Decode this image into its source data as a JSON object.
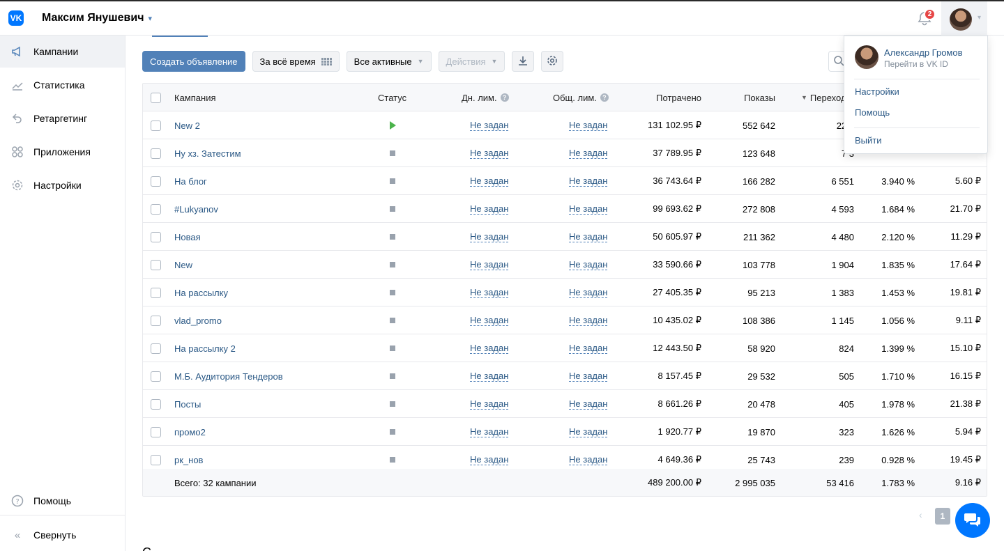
{
  "header": {
    "logo_text": "VK",
    "account_name": "Максим Янушевич",
    "notifications_count": "2"
  },
  "sidebar": {
    "items": [
      {
        "label": "Кампании",
        "icon": "megaphone-icon",
        "active": true
      },
      {
        "label": "Статистика",
        "icon": "chart-icon"
      },
      {
        "label": "Ретаргетинг",
        "icon": "retarget-icon"
      },
      {
        "label": "Приложения",
        "icon": "apps-icon"
      },
      {
        "label": "Настройки",
        "icon": "gear-icon"
      }
    ],
    "help_label": "Помощь",
    "collapse_label": "Свернуть"
  },
  "toolbar": {
    "create_label": "Создать объявление",
    "period_label": "За всё время",
    "filter_label": "Все активные",
    "actions_label": "Действия"
  },
  "table": {
    "columns": {
      "name": "Кампания",
      "status": "Статус",
      "day_limit": "Дн. лим.",
      "total_limit": "Общ. лим.",
      "spent": "Потрачено",
      "impressions": "Показы",
      "clicks": "Переходы"
    },
    "limit_text": "Не задан",
    "rows": [
      {
        "name": "New 2",
        "status": "active",
        "spent": "131 102.95 ₽",
        "impressions": "552 642",
        "clicks": "22 8",
        "ctr": "",
        "cpc": ""
      },
      {
        "name": "Ну хз. Затестим",
        "status": "stopped",
        "spent": "37 789.95 ₽",
        "impressions": "123 648",
        "clicks": "7 3",
        "ctr": "",
        "cpc": ""
      },
      {
        "name": "На блог",
        "status": "stopped",
        "spent": "36 743.64 ₽",
        "impressions": "166 282",
        "clicks": "6 551",
        "ctr": "3.940 %",
        "cpc": "5.60 ₽"
      },
      {
        "name": "#Lukyanov",
        "status": "stopped",
        "spent": "99 693.62 ₽",
        "impressions": "272 808",
        "clicks": "4 593",
        "ctr": "1.684 %",
        "cpc": "21.70 ₽"
      },
      {
        "name": "Новая",
        "status": "stopped",
        "spent": "50 605.97 ₽",
        "impressions": "211 362",
        "clicks": "4 480",
        "ctr": "2.120 %",
        "cpc": "11.29 ₽"
      },
      {
        "name": "New",
        "status": "stopped",
        "spent": "33 590.66 ₽",
        "impressions": "103 778",
        "clicks": "1 904",
        "ctr": "1.835 %",
        "cpc": "17.64 ₽"
      },
      {
        "name": "На рассылку",
        "status": "stopped",
        "spent": "27 405.35 ₽",
        "impressions": "95 213",
        "clicks": "1 383",
        "ctr": "1.453 %",
        "cpc": "19.81 ₽"
      },
      {
        "name": "vlad_promo",
        "status": "stopped",
        "spent": "10 435.02 ₽",
        "impressions": "108 386",
        "clicks": "1 145",
        "ctr": "1.056 %",
        "cpc": "9.11 ₽"
      },
      {
        "name": "На рассылку 2",
        "status": "stopped",
        "spent": "12 443.50 ₽",
        "impressions": "58 920",
        "clicks": "824",
        "ctr": "1.399 %",
        "cpc": "15.10 ₽"
      },
      {
        "name": "М.Б. Аудитория Тендеров",
        "status": "stopped",
        "spent": "8 157.45 ₽",
        "impressions": "29 532",
        "clicks": "505",
        "ctr": "1.710 %",
        "cpc": "16.15 ₽"
      },
      {
        "name": "Посты",
        "status": "stopped",
        "spent": "8 661.26 ₽",
        "impressions": "20 478",
        "clicks": "405",
        "ctr": "1.978 %",
        "cpc": "21.38 ₽"
      },
      {
        "name": "промо2",
        "status": "stopped",
        "spent": "1 920.77 ₽",
        "impressions": "19 870",
        "clicks": "323",
        "ctr": "1.626 %",
        "cpc": "5.94 ₽"
      },
      {
        "name": "рк_нов",
        "status": "stopped",
        "spent": "4 649.36 ₽",
        "impressions": "25 743",
        "clicks": "239",
        "ctr": "0.928 %",
        "cpc": "19.45 ₽"
      }
    ],
    "total": {
      "label": "Всего: 32 кампании",
      "spent": "489 200.00 ₽",
      "impressions": "2 995 035",
      "clicks": "53 416",
      "ctr": "1.783 %",
      "cpc": "9.16 ₽"
    }
  },
  "pagination": {
    "current_page": "1"
  },
  "footer_cut_text": "С",
  "user_menu": {
    "name": "Александр Громов",
    "subtitle": "Перейти в VK ID",
    "settings_label": "Настройки",
    "help_label": "Помощь",
    "logout_label": "Выйти"
  },
  "colors": {
    "accent": "#5181b8",
    "link": "#2a5885",
    "active_status": "#4bb34b",
    "badge": "#e64646",
    "chat": "#0077ff"
  }
}
